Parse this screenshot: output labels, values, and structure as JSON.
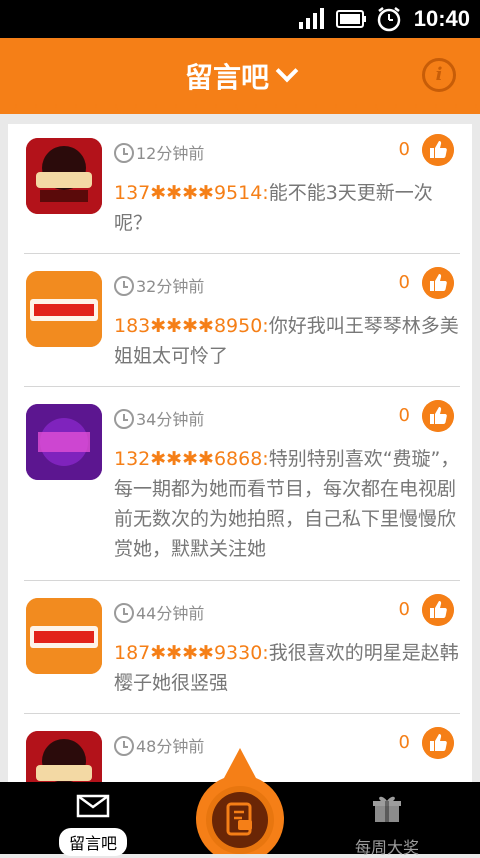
{
  "status_bar": {
    "time": "10:40"
  },
  "header": {
    "title": "留言吧"
  },
  "posts": [
    {
      "time": "12分钟前",
      "likes": "0",
      "phone": "137✱✱✱✱9514:",
      "text": "能不能3天更新一次呢？",
      "avatar": "show-logo-avatar"
    },
    {
      "time": "32分钟前",
      "likes": "0",
      "phone": "183✱✱✱✱8950:",
      "text": "你好我叫王琴琴林多美姐姐太可怜了",
      "avatar": "730-avatar"
    },
    {
      "time": "34分钟前",
      "likes": "0",
      "phone": "132✱✱✱✱6868:",
      "text": "特别特别喜欢“费璇”，每一期都为她而看节目，每次都在电视剧前无数次的为她拍照，自己私下里慢慢欣赏她，默默关注她",
      "avatar": "purple-show-avatar"
    },
    {
      "time": "44分钟前",
      "likes": "0",
      "phone": "187✱✱✱✱9330:",
      "text": "我很喜欢的明星是赵韩樱子她很竖强",
      "avatar": "730-avatar"
    },
    {
      "time": "48分钟前",
      "likes": "0",
      "phone": "",
      "text": "",
      "avatar": "show-logo-avatar"
    }
  ],
  "tabs": {
    "left_label": "留言吧",
    "right_label": "每周大奖"
  },
  "colors": {
    "accent": "#f57f17",
    "accent_dark": "#c75d08",
    "text_gray": "#777777"
  }
}
